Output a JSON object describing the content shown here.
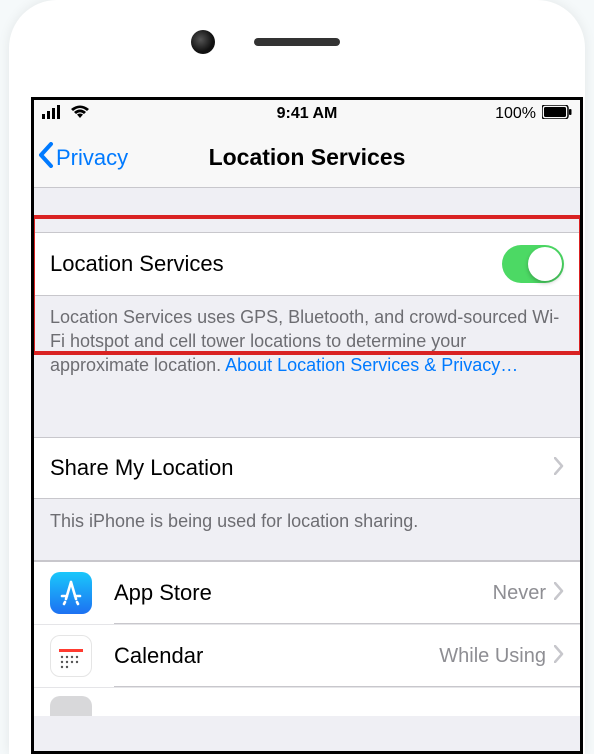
{
  "status_bar": {
    "time": "9:41 AM",
    "battery": "100%"
  },
  "nav": {
    "back_label": "Privacy",
    "title": "Location Services"
  },
  "main_toggle": {
    "label": "Location Services",
    "enabled": true
  },
  "description": {
    "text": "Location Services uses GPS, Bluetooth, and crowd-sourced Wi-Fi hotspot and cell tower locations to determine your approximate location. ",
    "link": "About Location Services & Privacy…"
  },
  "share": {
    "label": "Share My Location",
    "footer": "This iPhone is being used for location sharing."
  },
  "apps": [
    {
      "name": "App Store",
      "status": "Never",
      "icon": "appstore"
    },
    {
      "name": "Calendar",
      "status": "While Using",
      "icon": "calendar"
    }
  ]
}
